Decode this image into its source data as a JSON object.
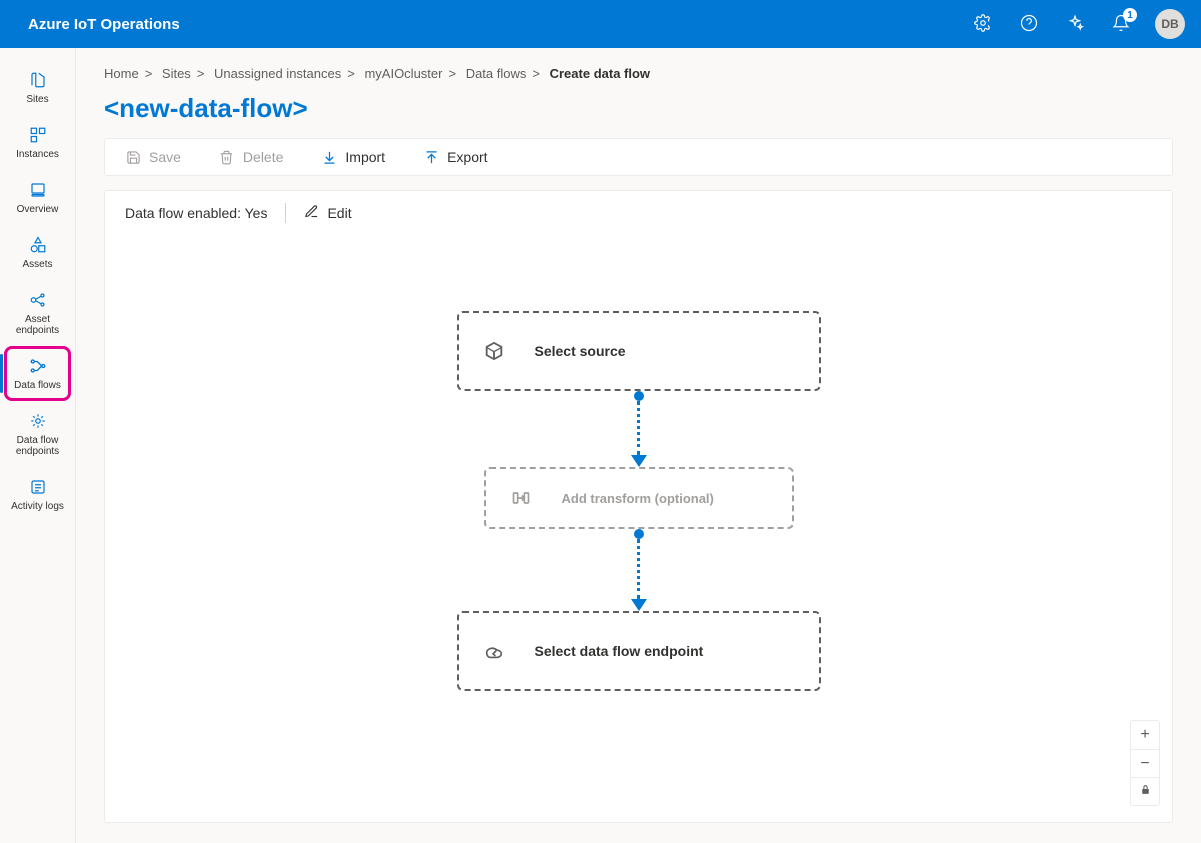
{
  "header": {
    "title": "Azure IoT Operations",
    "notifications_count": "1",
    "avatar_initials": "DB"
  },
  "sidebar": {
    "items": [
      {
        "label": "Sites"
      },
      {
        "label": "Instances"
      },
      {
        "label": "Overview"
      },
      {
        "label": "Assets"
      },
      {
        "label": "Asset endpoints"
      },
      {
        "label": "Data flows"
      },
      {
        "label": "Data flow endpoints"
      },
      {
        "label": "Activity logs"
      }
    ]
  },
  "breadcrumb": {
    "items": [
      {
        "label": "Home"
      },
      {
        "label": "Sites"
      },
      {
        "label": "Unassigned instances"
      },
      {
        "label": "myAIOcluster"
      },
      {
        "label": "Data flows"
      }
    ],
    "current": "Create data flow"
  },
  "page": {
    "title": "<new-data-flow>"
  },
  "toolbar": {
    "save": "Save",
    "delete": "Delete",
    "import": "Import",
    "export": "Export"
  },
  "status": {
    "text": "Data flow enabled: Yes",
    "edit_label": "Edit"
  },
  "canvas": {
    "source_label": "Select source",
    "transform_label": "Add transform (optional)",
    "endpoint_label": "Select data flow endpoint"
  },
  "zoom": {
    "in": "+",
    "out": "−",
    "fit": "⛶"
  }
}
